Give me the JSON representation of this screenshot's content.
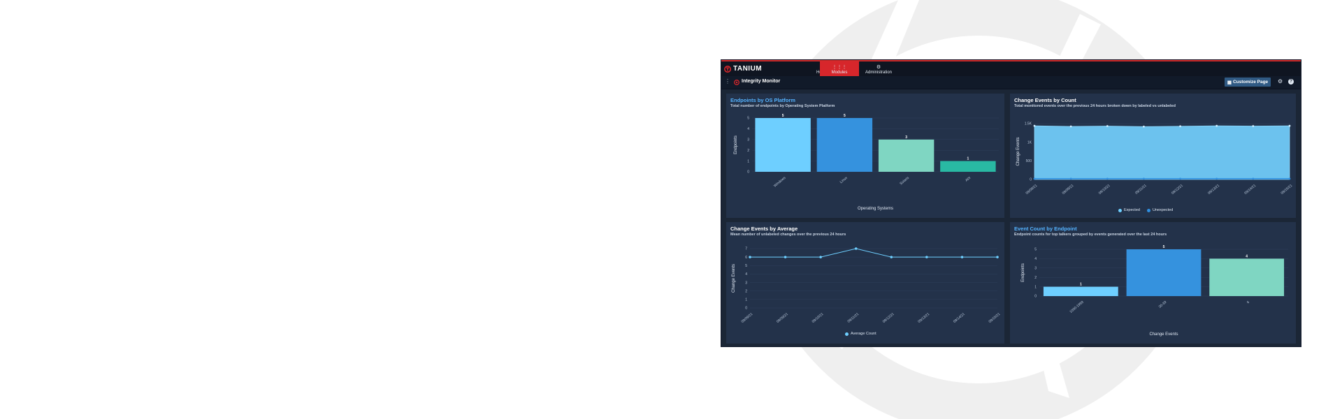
{
  "colors": {
    "brand_red": "#d7262b",
    "light_blue": "#6ecfff",
    "mid_blue": "#3592de",
    "teal": "#7fd6c2",
    "green_teal": "#29b9a3",
    "area_fill": "#6cc2ee",
    "line_blue": "#2f8fe0",
    "panel_bg": "#23324a"
  },
  "topnav": {
    "brand": "TANIUM",
    "items": [
      {
        "label": "Home",
        "icon": "home-icon"
      },
      {
        "label": "Modules",
        "icon": "grid-icon",
        "active": true
      },
      {
        "label": "Administration",
        "icon": "gears-icon"
      }
    ]
  },
  "pagebar": {
    "title": "Integrity Monitor",
    "customize_label": "Customize Page",
    "icons": [
      "kebab-menu-icon",
      "integrity-monitor-icon",
      "gear-icon",
      "help-icon"
    ]
  },
  "panels": {
    "os_platform": {
      "title": "Endpoints by OS Platform",
      "subtitle": "Total number of endpoints by Operating System Platform"
    },
    "events_count": {
      "title": "Change Events by Count",
      "subtitle": "Total monitored events over the previous 24 hours broken down by labeled vs unlabeled"
    },
    "events_average": {
      "title": "Change Events by Average",
      "subtitle": "Mean number of unlabeled changes over the previous 24 hours"
    },
    "event_count_endpoint": {
      "title": "Event Count by Endpoint",
      "subtitle": "Endpoint counts for top talkers grouped by events generated over the last 24 hours"
    }
  },
  "chart_data": [
    {
      "type": "bar",
      "categories": [
        "Windows",
        "Linux",
        "Solaris",
        "AIX"
      ],
      "values": [
        5,
        5,
        3,
        1
      ],
      "xlabel": "Operating Systems",
      "ylabel": "Endpoints",
      "ylim": [
        0,
        5
      ],
      "yticks": [
        "0",
        "1",
        "2",
        "3",
        "4",
        "5"
      ],
      "bar_colors": [
        "#6ecfff",
        "#3592de",
        "#7fd6c2",
        "#29b9a3"
      ]
    },
    {
      "type": "area",
      "x": [
        "09/09/21",
        "09/09/21",
        "09/10/21",
        "09/11/21",
        "09/12/21",
        "09/13/21",
        "09/14/21",
        "09/15/21"
      ],
      "series": [
        {
          "name": "Expected",
          "values": [
            1440,
            1425,
            1435,
            1420,
            1430,
            1440,
            1435,
            1440
          ]
        },
        {
          "name": "Unexpected",
          "values": [
            20,
            20,
            20,
            20,
            20,
            20,
            20,
            20
          ]
        }
      ],
      "ylabel": "Change Events",
      "ylim": [
        0,
        1500
      ],
      "yticks": [
        "0",
        "500",
        "1K",
        "1.5K"
      ],
      "legend": "bottom"
    },
    {
      "type": "line",
      "x": [
        "09/09/21",
        "09/09/21",
        "09/10/21",
        "09/11/21",
        "09/12/21",
        "09/13/21",
        "09/14/21",
        "09/15/21"
      ],
      "series": [
        {
          "name": "Average Count",
          "values": [
            6,
            6,
            6,
            7,
            6,
            6,
            6,
            6
          ]
        }
      ],
      "ylabel": "Change Events",
      "ylim": [
        0,
        7
      ],
      "yticks": [
        "0",
        "1",
        "2",
        "3",
        "4",
        "5",
        "6",
        "7"
      ],
      "legend": "bottom"
    },
    {
      "type": "bar",
      "categories": [
        "1000-1999",
        "30-39",
        "6"
      ],
      "values": [
        1,
        5,
        4
      ],
      "xlabel": "Change Events",
      "ylabel": "Endpoints",
      "ylim": [
        0,
        5
      ],
      "yticks": [
        "0",
        "1",
        "2",
        "3",
        "4",
        "5"
      ],
      "bar_colors": [
        "#6ecfff",
        "#3592de",
        "#7fd6c2"
      ]
    }
  ]
}
